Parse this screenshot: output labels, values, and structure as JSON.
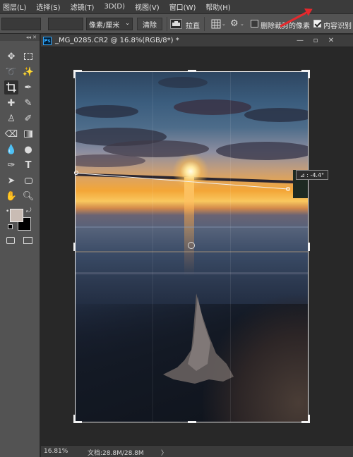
{
  "menu": [
    "图层(L)",
    "选择(S)",
    "滤镜(T)",
    "3D(D)",
    "视图(V)",
    "窗口(W)",
    "帮助(H)"
  ],
  "options": {
    "unit_select": "像素/厘米",
    "clear_label": "清除",
    "straighten_label": "拉直",
    "delete_cropped_label": "删除裁剪的像素",
    "delete_cropped_checked": false,
    "content_aware_label": "内容识别",
    "content_aware_checked": true
  },
  "document": {
    "tab_title": "_MG_0285.CR2 @ 16.8%(RGB/8*) *",
    "ps_badge": "Ps"
  },
  "canvas": {
    "angle_readout": "⊿ : -4.4°"
  },
  "status": {
    "zoom": "16.81%",
    "doc_size": "文档:28.8M/28.8M",
    "chevron": "〉"
  },
  "toolbox": {
    "collapse": "◂◂ ✕",
    "more": "•••"
  },
  "colors": {
    "foreground": "#c9bcb4",
    "background": "#000000",
    "annotation_arrow": "#e5292d"
  }
}
